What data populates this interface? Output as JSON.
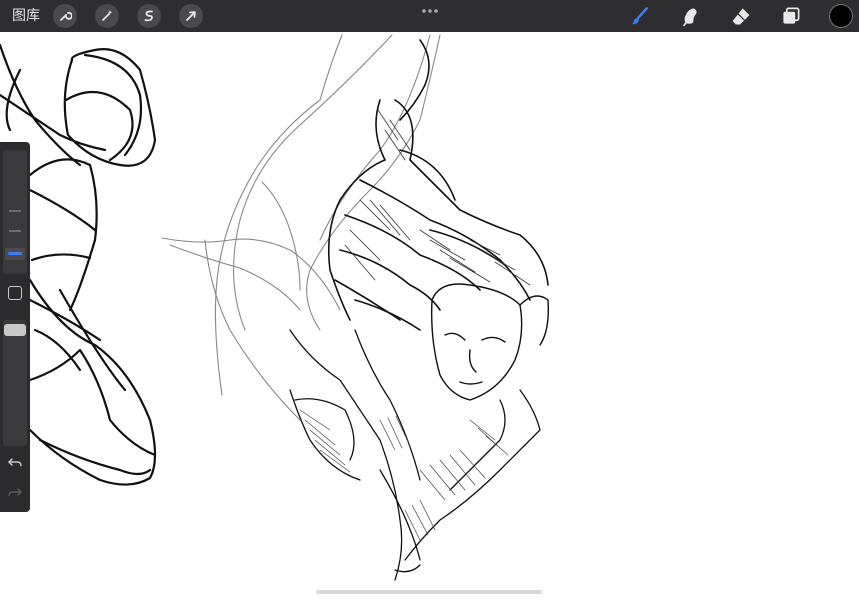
{
  "app": {
    "gallery_label": "图库"
  },
  "toolbar": {
    "left_tools": [
      "wrench-icon",
      "magic-wand-icon",
      "selection-icon",
      "transform-arrow-icon"
    ],
    "right_tools": [
      "brush-icon",
      "smudge-icon",
      "eraser-icon",
      "layers-icon"
    ],
    "active_tool": "brush-icon",
    "accent_color": "#3d7bf2",
    "current_color": "#000000"
  },
  "sidebar": {
    "size_slider_level": 0.78,
    "opacity_slider_level": 0.0,
    "controls": [
      "brush-size-slider",
      "modify-button",
      "opacity-slider",
      "undo-icon",
      "redo-icon"
    ]
  },
  "canvas": {
    "content": "sketch",
    "background": "#ffffff"
  }
}
